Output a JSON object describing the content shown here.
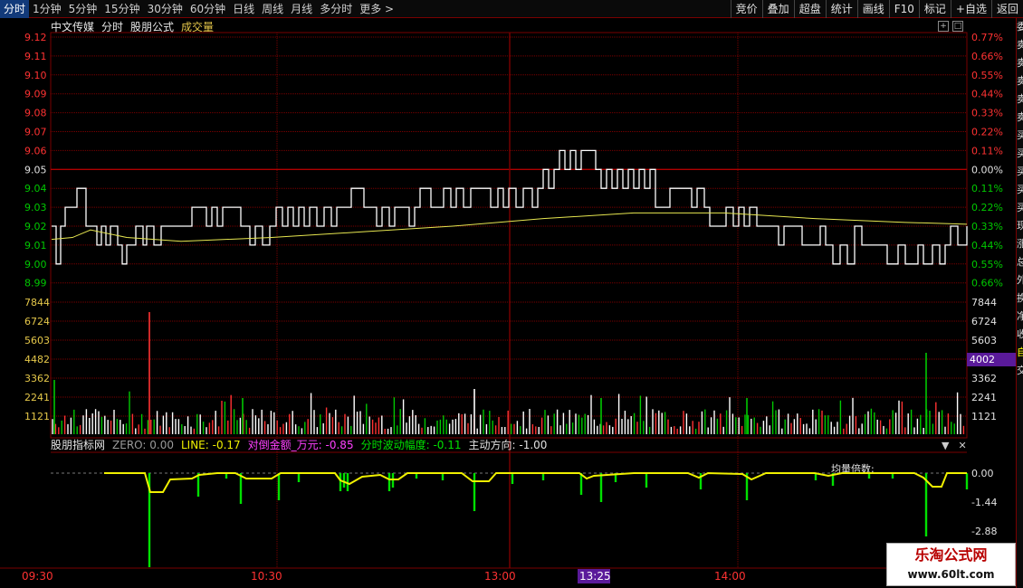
{
  "toolbar": {
    "periods": [
      "分时",
      "1分钟",
      "5分钟",
      "15分钟",
      "30分钟",
      "60分钟",
      "日线",
      "周线",
      "月线",
      "多分时",
      "更多 >"
    ],
    "tools": [
      "竞价",
      "叠加",
      "超盘",
      "统计",
      "画线",
      "F10",
      "标记",
      "+自选",
      "返回"
    ]
  },
  "header": {
    "stock_name": "中文传媒",
    "view": "分时",
    "formula": "股朋公式",
    "volume_label": "成交量"
  },
  "price_axis": {
    "left": [
      "9.12",
      "9.11",
      "9.10",
      "9.09",
      "9.08",
      "9.07",
      "9.06",
      "9.05",
      "9.04",
      "9.03",
      "9.02",
      "9.01",
      "9.00",
      "8.99"
    ],
    "right": [
      "0.77%",
      "0.66%",
      "0.55%",
      "0.44%",
      "0.33%",
      "0.22%",
      "0.11%",
      "0.00%",
      "0.11%",
      "0.22%",
      "0.33%",
      "0.44%",
      "0.55%",
      "0.66%"
    ],
    "prev_close": "9.05"
  },
  "volume_axis": {
    "labels": [
      "7844",
      "6724",
      "5603",
      "4482",
      "3362",
      "2241",
      "1121"
    ],
    "current": "4002"
  },
  "indicator": {
    "name": "股朋指标网",
    "zero": "ZERO: 0.00",
    "line": "LINE: -0.17",
    "amount": "对倒金额_万元: -0.85",
    "volatility": "分时波动幅度: -0.11",
    "direction": "主动方向: -1.00",
    "axis": [
      "0.00",
      "-1.44",
      "-2.88"
    ],
    "annotation": "均量倍数:"
  },
  "time_axis": {
    "labels": [
      "09:30",
      "10:30",
      "13:00",
      "14:00"
    ],
    "cursor": "13:25"
  },
  "colors": {
    "up": "#ff3232",
    "down": "#00c800",
    "grid": "#7a0000",
    "price_line": "#ffffff",
    "avg_line": "#e6e650",
    "indicator_line": "#f0f000"
  },
  "watermark": {
    "title": "乐淘公式网",
    "url": "www.60lt.com"
  }
}
